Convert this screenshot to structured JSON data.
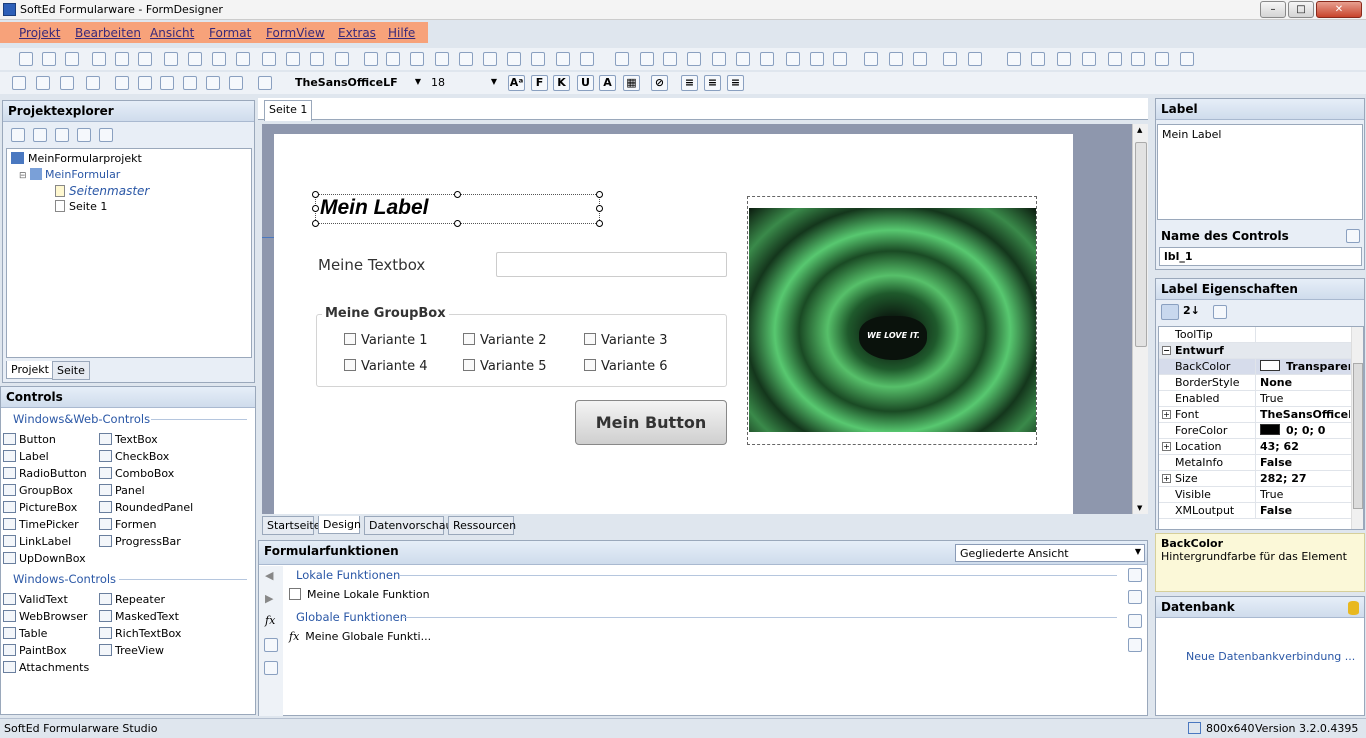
{
  "window": {
    "title": "SoftEd Formularware - FormDesigner",
    "min": "–",
    "max": "□",
    "close": "✕"
  },
  "menu": [
    "Projekt",
    "Bearbeiten",
    "Ansicht",
    "Format",
    "FormView",
    "Extras",
    "Hilfe"
  ],
  "format_toolbar": {
    "font": "TheSansOfficeLF",
    "size": "18"
  },
  "projekt": {
    "title": "Projektexplorer",
    "tree": [
      "MeinFormularprojekt",
      "MeinFormular",
      "Seitenmaster",
      "Seite 1"
    ],
    "tabs": [
      "Projekt",
      "Seite"
    ]
  },
  "controls": {
    "title": "Controls",
    "web_header": "Windows&Web-Controls",
    "web_left": [
      "Button",
      "Label",
      "RadioButton",
      "GroupBox",
      "PictureBox",
      "TimePicker",
      "LinkLabel",
      "UpDownBox"
    ],
    "web_right": [
      "TextBox",
      "CheckBox",
      "ComboBox",
      "Panel",
      "RoundedPanel",
      "Formen",
      "ProgressBar"
    ],
    "win_header": "Windows-Controls",
    "win_left": [
      "ValidText",
      "WebBrowser",
      "Table",
      "PaintBox",
      "Attachments"
    ],
    "win_right": [
      "Repeater",
      "MaskedText",
      "RichTextBox",
      "TreeView"
    ]
  },
  "designer": {
    "page_tab": "Seite 1",
    "label": "Mein Label",
    "textbox_label": "Meine Textbox",
    "groupbox": "Meine GroupBox",
    "options": [
      "Variante 1",
      "Variante 2",
      "Variante 3",
      "Variante 4",
      "Variante 5",
      "Variante 6"
    ],
    "button": "Mein Button",
    "image_text": "WE LOVE IT.",
    "bottom_tabs": [
      "Startseite",
      "Design",
      "Datenvorschau",
      "Ressourcen"
    ]
  },
  "funktionen": {
    "title": "Formularfunktionen",
    "view": "Gegliederte Ansicht",
    "local_header": "Lokale Funktionen",
    "local_item": "Meine Lokale Funktion",
    "global_header": "Globale Funktionen",
    "global_item": "Meine Globale Funkti..."
  },
  "label_panel": {
    "title": "Label",
    "content": "Mein Label",
    "name_header": "Name des Controls",
    "name_value": "lbl_1"
  },
  "props": {
    "title": "Label Eigenschaften",
    "rows": [
      {
        "k": "ToolTip",
        "v": ""
      },
      {
        "k": "Entwurf",
        "v": ""
      },
      {
        "k": "BackColor",
        "v": "Transparent"
      },
      {
        "k": "BorderStyle",
        "v": "None"
      },
      {
        "k": "Enabled",
        "v": "True"
      },
      {
        "k": "Font",
        "v": "TheSansOfficeLF"
      },
      {
        "k": "ForeColor",
        "v": "0; 0; 0"
      },
      {
        "k": "Location",
        "v": "43; 62"
      },
      {
        "k": "MetaInfo",
        "v": "False"
      },
      {
        "k": "Size",
        "v": "282; 27"
      },
      {
        "k": "Visible",
        "v": "True"
      },
      {
        "k": "XMLoutput",
        "v": "False"
      }
    ],
    "help_title": "BackColor",
    "help_text": "Hintergrundfarbe für das Element"
  },
  "datenbank": {
    "title": "Datenbank",
    "link": "Neue Datenbankverbindung ..."
  },
  "status": {
    "left": "SoftEd Formularware Studio",
    "size": "800x640",
    "version": "Version 3.2.0.4395"
  },
  "colors": {
    "menu_highlight": "#f7a27a",
    "panel_header": "#cfdcec",
    "link": "#2a57a6"
  }
}
